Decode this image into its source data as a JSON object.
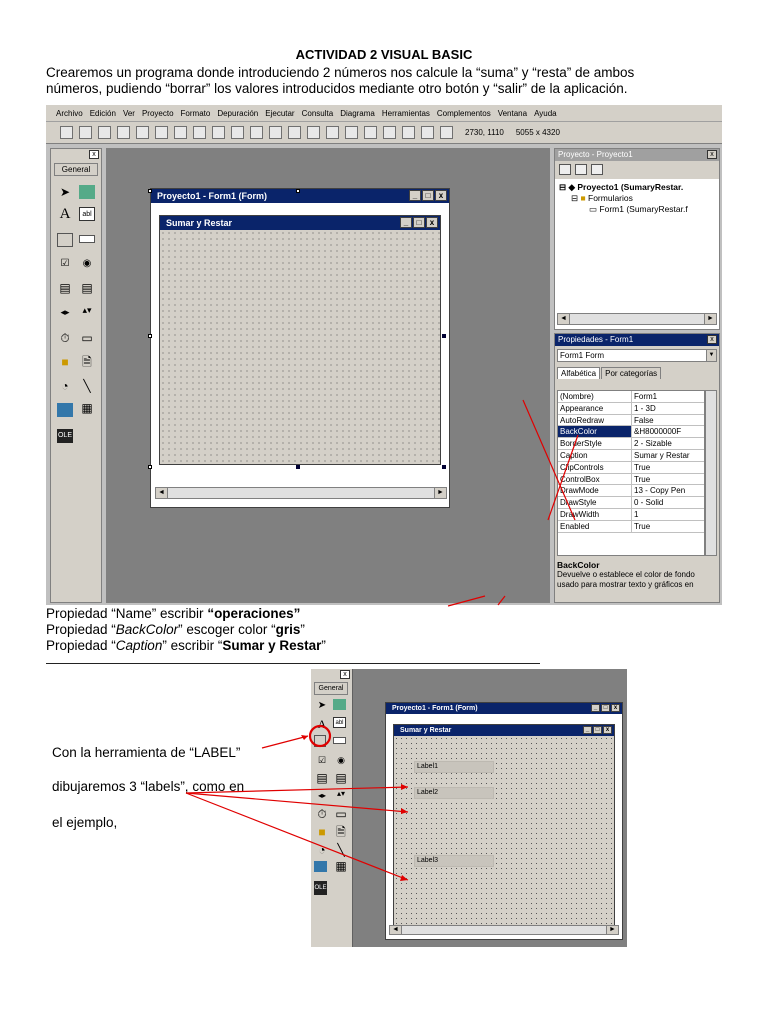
{
  "doc": {
    "title": "ACTIVIDAD 2 VISUAL BASIC",
    "intro_line1": "Crearemos un programa donde introduciendo 2 números nos calcule la “suma” y “resta” de ambos",
    "intro_line2": "números, pudiendo “borrar” los valores introducidos mediante otro botón y “salir” de la aplicación."
  },
  "ide": {
    "menu": [
      "Archivo",
      "Edición",
      "Ver",
      "Proyecto",
      "Formato",
      "Depuración",
      "Ejecutar",
      "Consulta",
      "Diagrama",
      "Herramientas",
      "Complementos",
      "Ventana",
      "Ayuda"
    ],
    "position_readout": "2730, 1110",
    "size_readout": "5055 x 4320",
    "toolbox_header": "General",
    "toolbox_close": "x",
    "project_window_title": "Proyecto1 - Form1 (Form)",
    "form_caption": "Sumar y Restar",
    "win_btn_min": "_",
    "win_btn_max": "□",
    "win_btn_close": "x",
    "scroll_left": "◄",
    "scroll_right": "►",
    "explorer": {
      "title": "Proyecto - Proyecto1",
      "root": "Proyecto1 (SumaryRestar.",
      "folder": "Formularios",
      "item": "Form1 (SumaryRestar.f"
    },
    "properties": {
      "title": "Propiedades - Form1",
      "object": "Form1  Form",
      "tab_alpha": "Alfabética",
      "tab_cat": "Por categorías",
      "rows": [
        {
          "k": "(Nombre)",
          "v": "Form1"
        },
        {
          "k": "Appearance",
          "v": "1 - 3D"
        },
        {
          "k": "AutoRedraw",
          "v": "False"
        },
        {
          "k": "BackColor",
          "v": "&H8000000F"
        },
        {
          "k": "BorderStyle",
          "v": "2 - Sizable"
        },
        {
          "k": "Caption",
          "v": "Sumar y Restar"
        },
        {
          "k": "ClipControls",
          "v": "True"
        },
        {
          "k": "ControlBox",
          "v": "True"
        },
        {
          "k": "DrawMode",
          "v": "13 - Copy Pen"
        },
        {
          "k": "DrawStyle",
          "v": "0 - Solid"
        },
        {
          "k": "DrawWidth",
          "v": "1"
        },
        {
          "k": "Enabled",
          "v": "True"
        }
      ],
      "desc_title": "BackColor",
      "desc_text": "Devuelve o establece el color de fondo usado para mostrar texto y gráficos en"
    }
  },
  "instructions": {
    "line1_prefix": "Propiedad “Name” escribir ",
    "line1_value": "“operaciones”",
    "line2_prefix": "Propiedad “",
    "line2_prop": "BackColor",
    "line2_mid": "” escoger color “",
    "line2_value": "gris",
    "line2_suffix": "”",
    "line3_prefix": "Propiedad “",
    "line3_prop": "Caption",
    "line3_mid": "” escribir “",
    "line3_value": "Sumar y Restar",
    "line3_suffix": "”"
  },
  "second": {
    "toolbox_header": "General",
    "window_title": "Proyecto1 - Form1 (Form)",
    "form_caption": "Sumar y Restar",
    "labels": [
      "Label1",
      "Label2",
      "Label3"
    ],
    "note_line1": "Con la herramienta de “LABEL”",
    "note_line2": "dibujaremos 3 “labels”, como en",
    "note_line3": "el ejemplo,"
  },
  "colors": {
    "titlebar": "#0a246a",
    "annotation": "#e00000",
    "chrome": "#d4d0c8"
  }
}
